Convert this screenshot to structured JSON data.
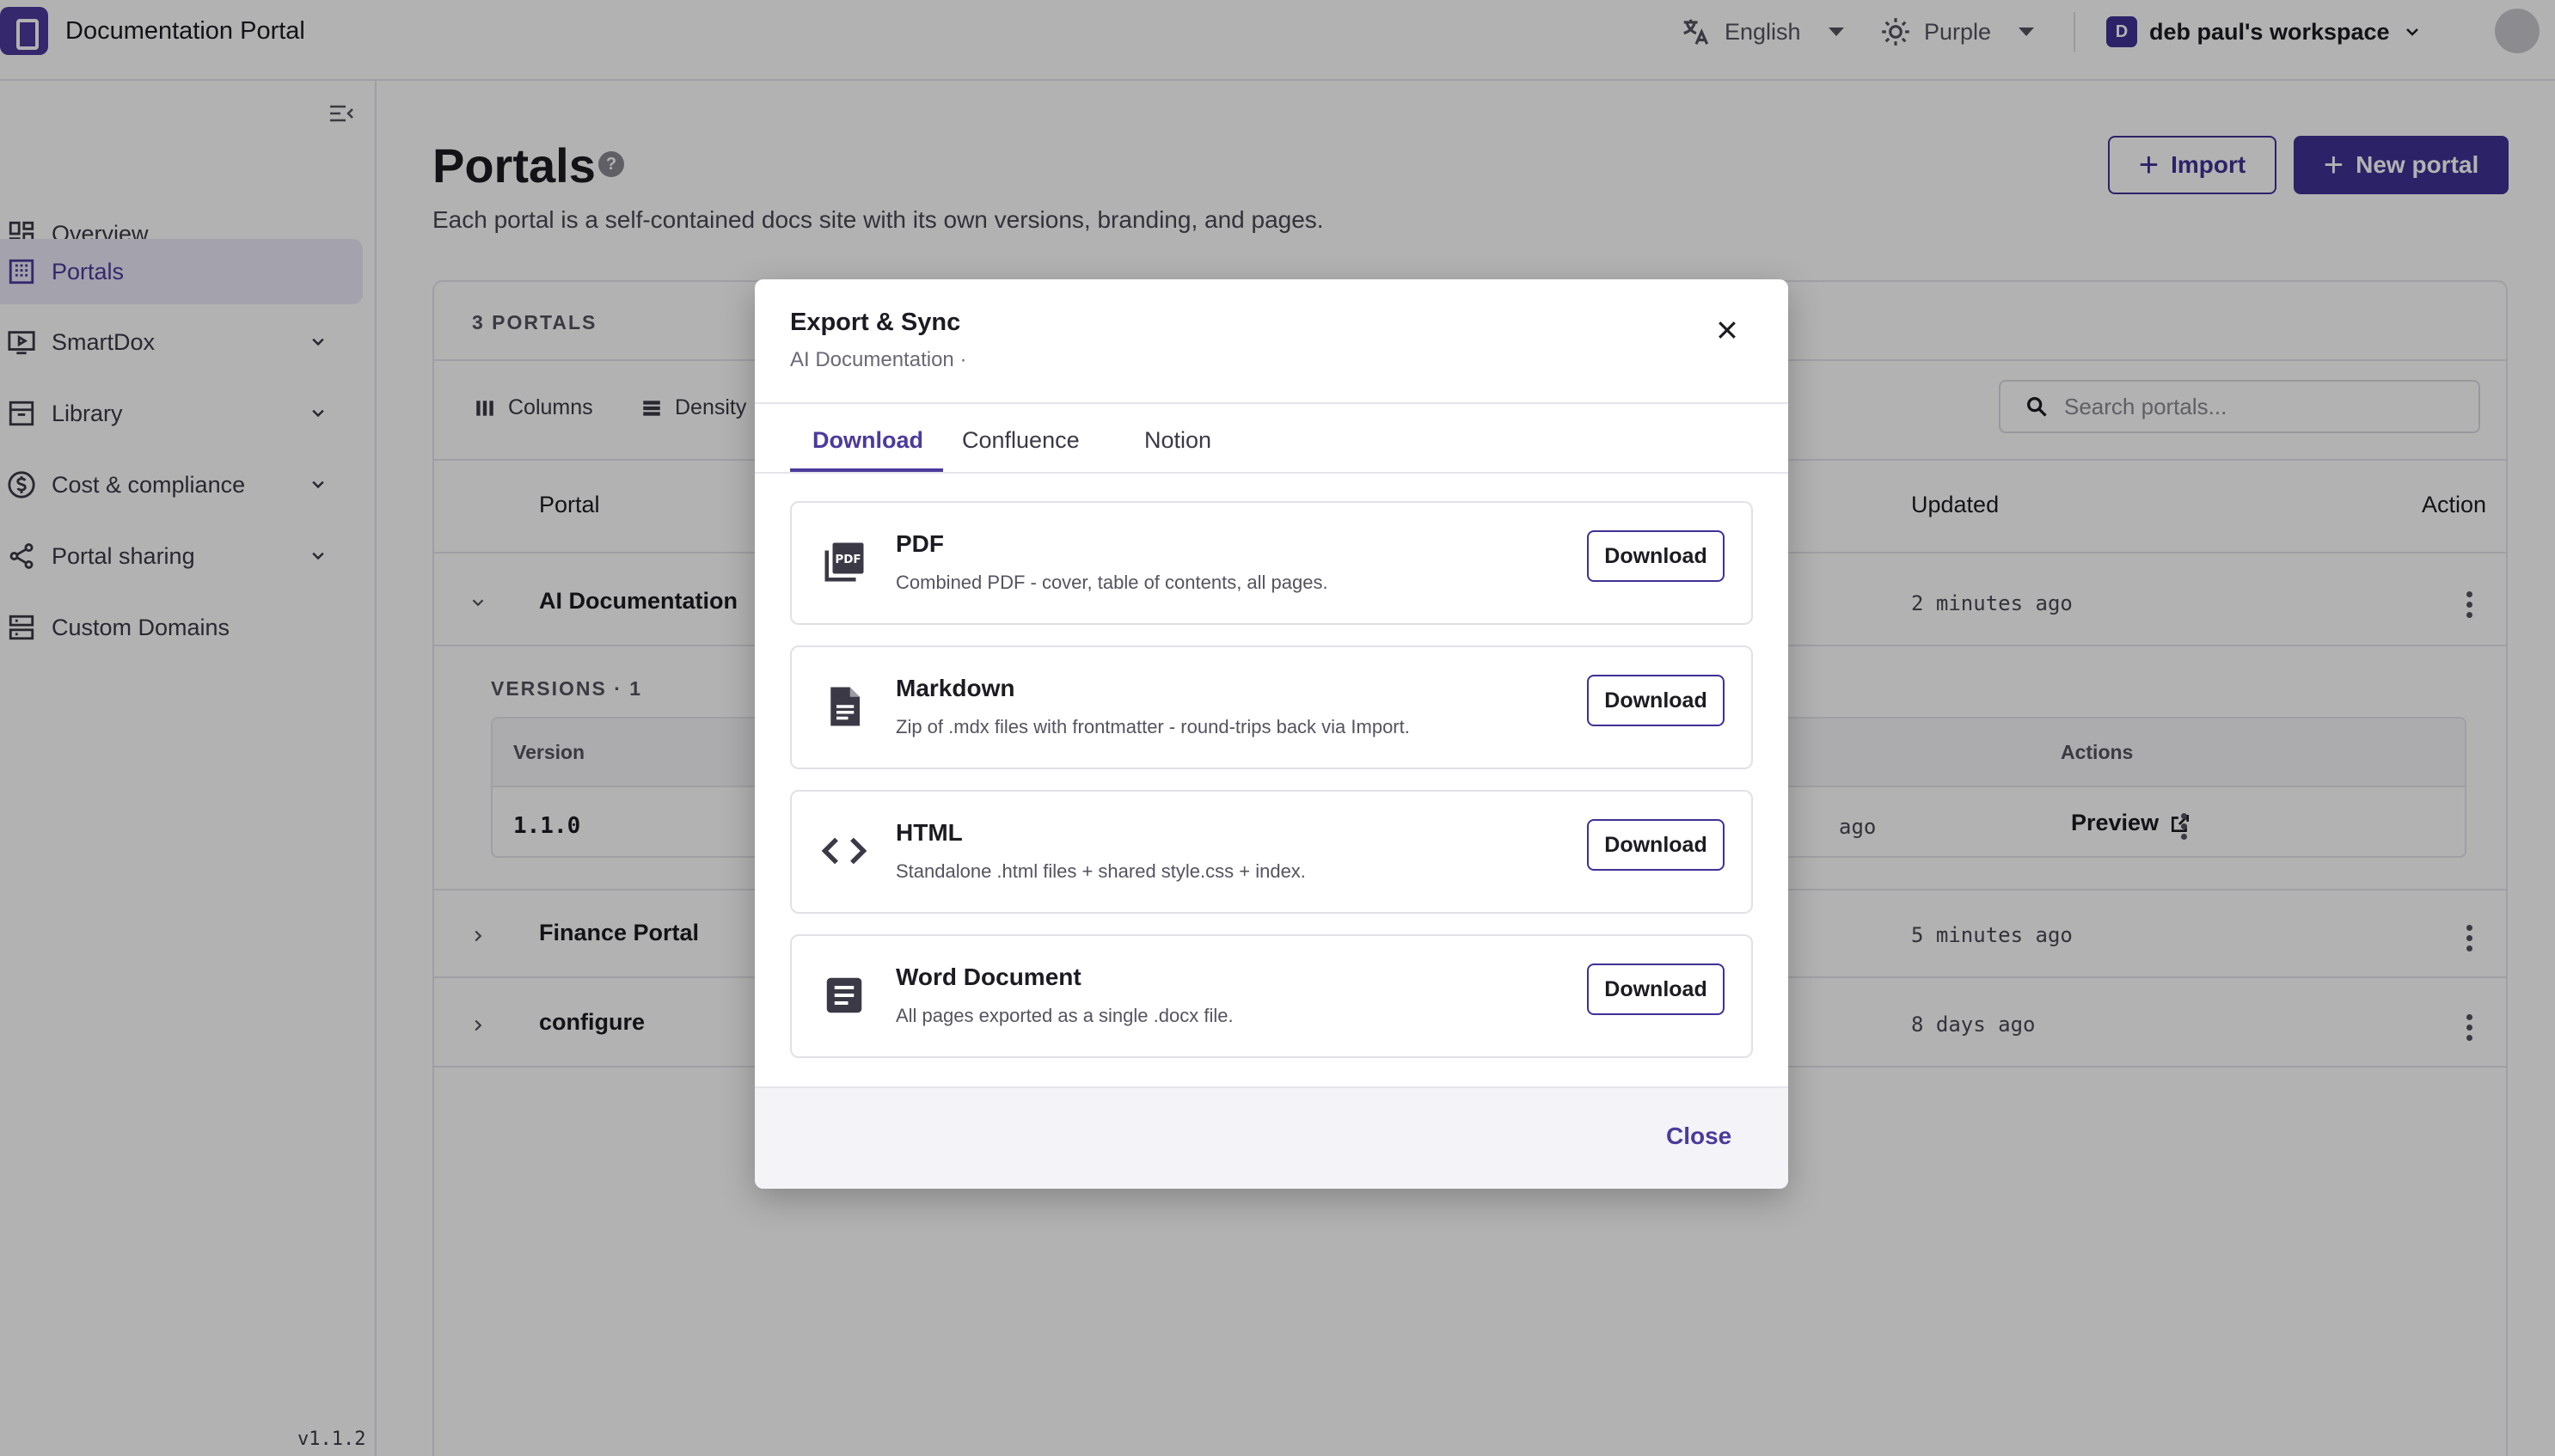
{
  "topbar": {
    "app_title": "Documentation Portal",
    "language": "English",
    "theme": "Purple",
    "workspace_initial": "D",
    "workspace_name": "deb paul's workspace"
  },
  "sidebar": {
    "items": [
      {
        "label": "Overview",
        "icon": "grid-icon"
      },
      {
        "label": "Portals",
        "icon": "building-icon",
        "active": true
      },
      {
        "label": "SmartDox",
        "icon": "play-screen-icon",
        "expandable": true
      },
      {
        "label": "Library",
        "icon": "archive-icon",
        "expandable": true
      },
      {
        "label": "Cost & compliance",
        "icon": "dollar-icon",
        "expandable": true
      },
      {
        "label": "Portal sharing",
        "icon": "share-icon",
        "expandable": true
      },
      {
        "label": "Custom Domains",
        "icon": "server-icon"
      }
    ],
    "version": "v1.1.2"
  },
  "main": {
    "title": "Portals",
    "subtitle": "Each portal is a self-contained docs site with its own versions, branding, and pages.",
    "import_label": "Import",
    "new_label": "New portal",
    "count_label": "3 PORTALS",
    "toolbar": {
      "columns": "Columns",
      "density": "Density"
    },
    "search_placeholder": "Search portals...",
    "columns": {
      "portal": "Portal",
      "updated": "Updated",
      "action": "Action"
    },
    "rows": [
      {
        "name": "AI Documentation",
        "updated": "2 minutes ago",
        "expanded": true
      },
      {
        "name": "Finance Portal",
        "updated": "5 minutes ago"
      },
      {
        "name": "configure",
        "updated": "8 days ago"
      }
    ],
    "versions": {
      "label": "VERSIONS · 1",
      "col_version": "Version",
      "col_actions": "Actions",
      "row_version": "1.1.0",
      "row_updated_fragment": "ago",
      "preview": "Preview"
    }
  },
  "modal": {
    "title": "Export & Sync",
    "subtitle": "AI Documentation ·",
    "tabs": [
      "Download",
      "Confluence",
      "Notion"
    ],
    "active_tab": "Download",
    "options": [
      {
        "title": "PDF",
        "desc": "Combined PDF - cover, table of contents, all pages.",
        "icon": "pdf-icon",
        "button": "Download"
      },
      {
        "title": "Markdown",
        "desc": "Zip of .mdx files with frontmatter - round-trips back via Import.",
        "icon": "document-icon",
        "button": "Download"
      },
      {
        "title": "HTML",
        "desc": "Standalone .html files + shared style.css + index.",
        "icon": "code-icon",
        "button": "Download"
      },
      {
        "title": "Word Document",
        "desc": "All pages exported as a single .docx file.",
        "icon": "word-doc-icon",
        "button": "Download"
      }
    ],
    "close_label": "Close"
  },
  "colors": {
    "accent": "#4c3a9c",
    "primary_button": "#3e3196",
    "active_nav_bg": "#ebe8f6"
  }
}
